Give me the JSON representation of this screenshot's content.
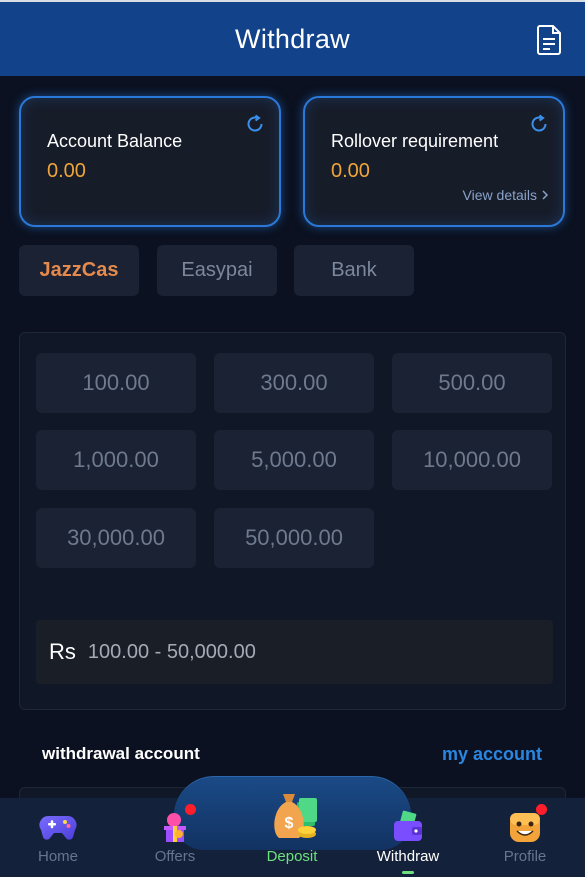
{
  "header": {
    "title": "Withdraw",
    "icon": "document-icon"
  },
  "balance": {
    "account": {
      "label": "Account Balance",
      "value": "0.00"
    },
    "rollover": {
      "label": "Rollover requirement",
      "value": "0.00",
      "details_label": "View details"
    }
  },
  "payment_methods": [
    {
      "label": "JazzCas",
      "active": true
    },
    {
      "label": "Easypai",
      "active": false
    },
    {
      "label": "Bank",
      "active": false
    }
  ],
  "amounts": [
    "100.00",
    "300.00",
    "500.00",
    "1,000.00",
    "5,000.00",
    "10,000.00",
    "30,000.00",
    "50,000.00"
  ],
  "range": {
    "currency": "Rs",
    "text": "100.00 - 50,000.00"
  },
  "withdrawal_account": {
    "label": "withdrawal account",
    "link": "my account"
  },
  "nav": {
    "items": [
      {
        "label": "Home",
        "icon": "gamepad-icon"
      },
      {
        "label": "Offers",
        "icon": "gift-icon"
      },
      {
        "label": "Deposit",
        "icon": "money-bag-icon"
      },
      {
        "label": "Withdraw",
        "icon": "wallet-icon"
      },
      {
        "label": "Profile",
        "icon": "smiley-icon"
      }
    ],
    "active": "Withdraw"
  },
  "colors": {
    "header": "#12428a",
    "accent_orange": "#f0a53a",
    "link_blue": "#2a86e0",
    "deposit_green": "#6ee07f"
  }
}
